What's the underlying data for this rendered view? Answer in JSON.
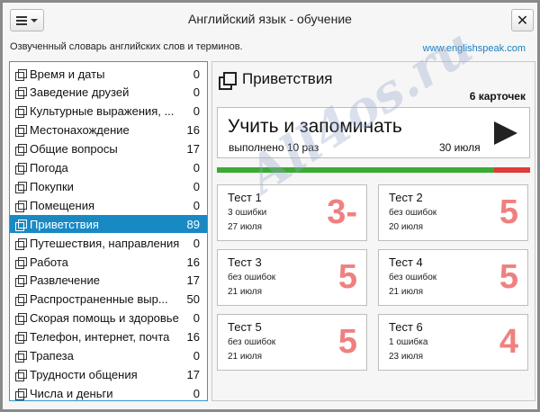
{
  "window": {
    "title": "Английский язык - обучение",
    "close_symbol": "✕"
  },
  "header": {
    "subtitle": "Озвученный словарь английских слов и терминов.",
    "site": "www.englishspeak.com"
  },
  "topics": [
    {
      "label": "Время и даты",
      "count": "0"
    },
    {
      "label": "Заведение друзей",
      "count": "0"
    },
    {
      "label": "Культурные выражения, ...",
      "count": "0"
    },
    {
      "label": "Местонахождение",
      "count": "16"
    },
    {
      "label": "Общие вопросы",
      "count": "17"
    },
    {
      "label": "Погода",
      "count": "0"
    },
    {
      "label": "Покупки",
      "count": "0"
    },
    {
      "label": "Помещения",
      "count": "0"
    },
    {
      "label": "Приветствия",
      "count": "89"
    },
    {
      "label": "Путешествия, направления",
      "count": "0"
    },
    {
      "label": "Работа",
      "count": "16"
    },
    {
      "label": "Развлечение",
      "count": "17"
    },
    {
      "label": "Распространенные выр...",
      "count": "50"
    },
    {
      "label": "Скорая помощь и здоровье",
      "count": "0"
    },
    {
      "label": "Телефон, интернет, почта",
      "count": "16"
    },
    {
      "label": "Трапеза",
      "count": "0"
    },
    {
      "label": "Трудности общения",
      "count": "17"
    },
    {
      "label": "Числа и деньги",
      "count": "0"
    }
  ],
  "selected_topic_index": 8,
  "detail": {
    "title": "Приветствия",
    "card_count": "6 карточек",
    "learn": {
      "label": "Учить и запоминать",
      "done": "выполнено 10 раз",
      "date": "30 июля"
    },
    "progress_known_fraction": 0.885,
    "tests": [
      {
        "name": "Тест 1",
        "errors": "3 ошибки",
        "date": "27 июля",
        "grade": "3-"
      },
      {
        "name": "Тест 2",
        "errors": "без ошибок",
        "date": "20 июля",
        "grade": "5"
      },
      {
        "name": "Тест 3",
        "errors": "без ошибок",
        "date": "21 июля",
        "grade": "5"
      },
      {
        "name": "Тест 4",
        "errors": "без ошибок",
        "date": "21 июля",
        "grade": "5"
      },
      {
        "name": "Тест 5",
        "errors": "без ошибок",
        "date": "21 июля",
        "grade": "5"
      },
      {
        "name": "Тест 6",
        "errors": "1 ошибка",
        "date": "23 июля",
        "grade": "4"
      }
    ]
  },
  "watermark": "All4os.ru",
  "colors": {
    "accent": "#1989c4",
    "progress_good": "#3aaa35",
    "progress_bad": "#e03a3a",
    "grade": "#f08080"
  }
}
